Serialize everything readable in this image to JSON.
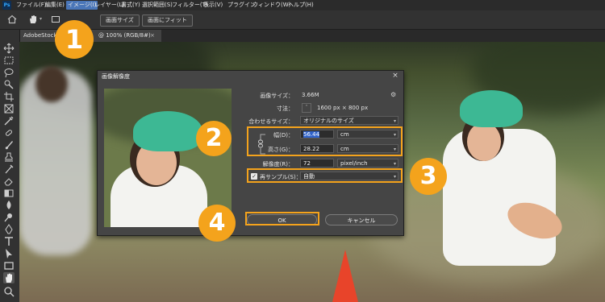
{
  "app_badge": "Ps",
  "menu": [
    "ファイル(F)",
    "編集(E)",
    "イメージ(I)",
    "レイヤー(L)",
    "書式(Y)",
    "選択範囲(S)",
    "フィルター(T)",
    "表示(V)",
    "プラグイン",
    "ウィンドウ(W)",
    "ヘルプ(H)"
  ],
  "options_bar": {
    "fit_screen": "画面サイズ",
    "fit_window": "画面にフィット"
  },
  "document_tab": {
    "name": "AdobeStock",
    "info": "@ 100% (RGB/8#)",
    "close": "×"
  },
  "dialog": {
    "title": "画像解像度",
    "close": "×",
    "image_size_label": "画像サイズ：",
    "image_size_value": "3.66M",
    "dimensions_label": "寸法：",
    "dimensions_value": "1600 px × 800 px",
    "fit_to_label": "合わせるサイズ：",
    "fit_to_value": "オリジナルのサイズ",
    "width_label": "幅(D)：",
    "width_value": "56.44",
    "width_unit": "cm",
    "height_label": "高さ(G)：",
    "height_value": "28.22",
    "height_unit": "cm",
    "resolution_label": "解像度(R)：",
    "resolution_value": "72",
    "resolution_unit": "pixel/inch",
    "resample_label": "再サンプル(S)：",
    "resample_checked": true,
    "resample_value": "自動",
    "ok_label": "OK",
    "cancel_label": "キャンセル"
  },
  "callouts": [
    "1",
    "2",
    "3",
    "4"
  ],
  "colors": {
    "accent_orange": "#f4a31c",
    "selected_menu": "#4a76b8",
    "hat_green": "#3db894"
  }
}
